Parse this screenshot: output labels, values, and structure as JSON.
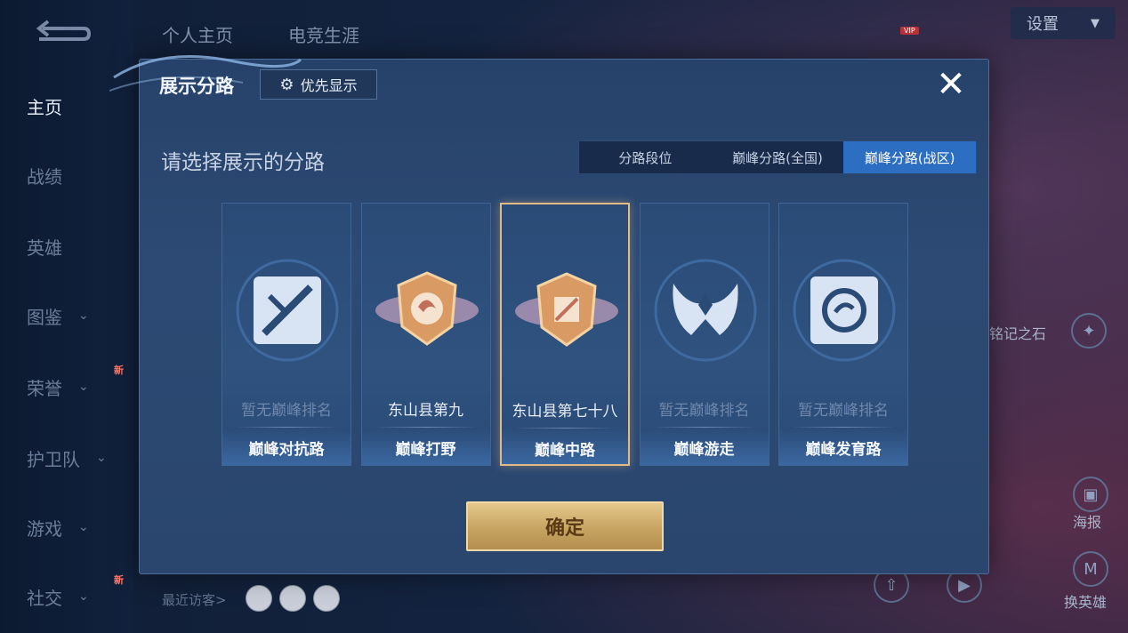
{
  "background": {
    "back_icon": "back-arrow-icon",
    "sidebar": [
      {
        "label": "主页",
        "active": true,
        "chevron": false,
        "new": false
      },
      {
        "label": "战绩",
        "active": false,
        "chevron": false,
        "new": false
      },
      {
        "label": "英雄",
        "active": false,
        "chevron": false,
        "new": false
      },
      {
        "label": "图鉴",
        "active": false,
        "chevron": true,
        "new": false
      },
      {
        "label": "荣誉",
        "active": false,
        "chevron": true,
        "new": true
      },
      {
        "label": "护卫队",
        "active": false,
        "chevron": true,
        "new": false
      },
      {
        "label": "游戏",
        "active": false,
        "chevron": true,
        "new": false
      },
      {
        "label": "社交",
        "active": false,
        "chevron": true,
        "new": true
      }
    ],
    "new_badge": "新",
    "top_tabs": [
      "个人主页",
      "电竞生涯"
    ],
    "settings_label": "设置",
    "vip_label": "VIP",
    "stone_label": "铭记之石",
    "poster_label": "海报",
    "change_hero_label": "换英雄",
    "recent_visitors": "最近访客>"
  },
  "modal": {
    "title": "展示分路",
    "priority_label": "优先显示",
    "close_icon": "close-icon",
    "subtitle": "请选择展示的分路",
    "segments": [
      {
        "label": "分路段位",
        "active": false
      },
      {
        "label": "巅峰分路(全国)",
        "active": false
      },
      {
        "label": "巅峰分路(战区)",
        "active": true
      }
    ],
    "cards": [
      {
        "rank": "暂无巅峰排名",
        "position": "巅峰对抗路",
        "icon": "clash-lane-icon",
        "has_rank": false,
        "selected": false
      },
      {
        "rank": "东山县第九",
        "position": "巅峰打野",
        "icon": "jungle-badge-icon",
        "has_rank": true,
        "selected": false
      },
      {
        "rank": "东山县第七十八",
        "position": "巅峰中路",
        "icon": "mid-lane-badge-icon",
        "has_rank": true,
        "selected": true
      },
      {
        "rank": "暂无巅峰排名",
        "position": "巅峰游走",
        "icon": "roam-icon",
        "has_rank": false,
        "selected": false
      },
      {
        "rank": "暂无巅峰排名",
        "position": "巅峰发育路",
        "icon": "farm-lane-icon",
        "has_rank": false,
        "selected": false
      }
    ],
    "confirm_label": "确定"
  },
  "colors": {
    "accent_blue": "#2c6fc2",
    "gold": "#e3b985",
    "modal_bg": "#2c4a74"
  }
}
